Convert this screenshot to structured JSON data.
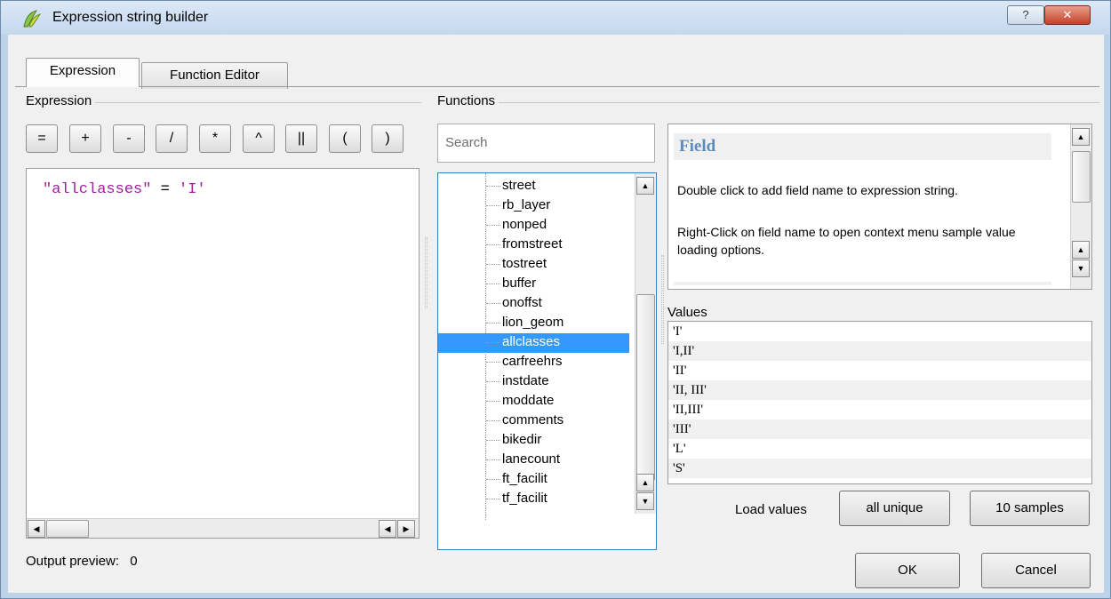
{
  "window": {
    "title": "Expression string builder",
    "help_glyph": "?",
    "close_glyph": "✕"
  },
  "tabs": [
    {
      "label": "Expression",
      "active": true
    },
    {
      "label": "Function Editor",
      "active": false
    }
  ],
  "expression_panel": {
    "group_label": "Expression",
    "operators": [
      "=",
      "+",
      "-",
      "/",
      "*",
      "^",
      "||",
      "(",
      ")"
    ],
    "text_field": "\"allclasses\"",
    "text_op": " = ",
    "text_value": "'I'",
    "output_preview_label": "Output preview:",
    "output_preview_value": "0"
  },
  "functions_panel": {
    "group_label": "Functions",
    "search_placeholder": "Search",
    "items": [
      "street",
      "rb_layer",
      "nonped",
      "fromstreet",
      "tostreet",
      "buffer",
      "onoffst",
      "lion_geom",
      "allclasses",
      "carfreehrs",
      "instdate",
      "moddate",
      "comments",
      "bikedir",
      "lanecount",
      "ft_facilit",
      "tf_facilit"
    ],
    "selected_item": "allclasses"
  },
  "help": {
    "title": "Field",
    "paragraph1": "Double click to add field name to expression string.",
    "paragraph2": "Right-Click on field name to open context menu sample value loading options."
  },
  "values": {
    "label": "Values",
    "items": [
      "'I'",
      "'I,II'",
      "'II'",
      "'II, III'",
      "'II,III'",
      "'III'",
      "'L'",
      "'S'"
    ],
    "load_label": "Load values",
    "all_unique_label": "all unique",
    "samples_label": "10 samples"
  },
  "footer": {
    "ok_label": "OK",
    "cancel_label": "Cancel"
  },
  "colors": {
    "expr_field": "#a020a0",
    "expr_op": "#000000",
    "expr_value": "#a020a0",
    "selection": "#3399ff",
    "help_title": "#5b8cbf"
  }
}
